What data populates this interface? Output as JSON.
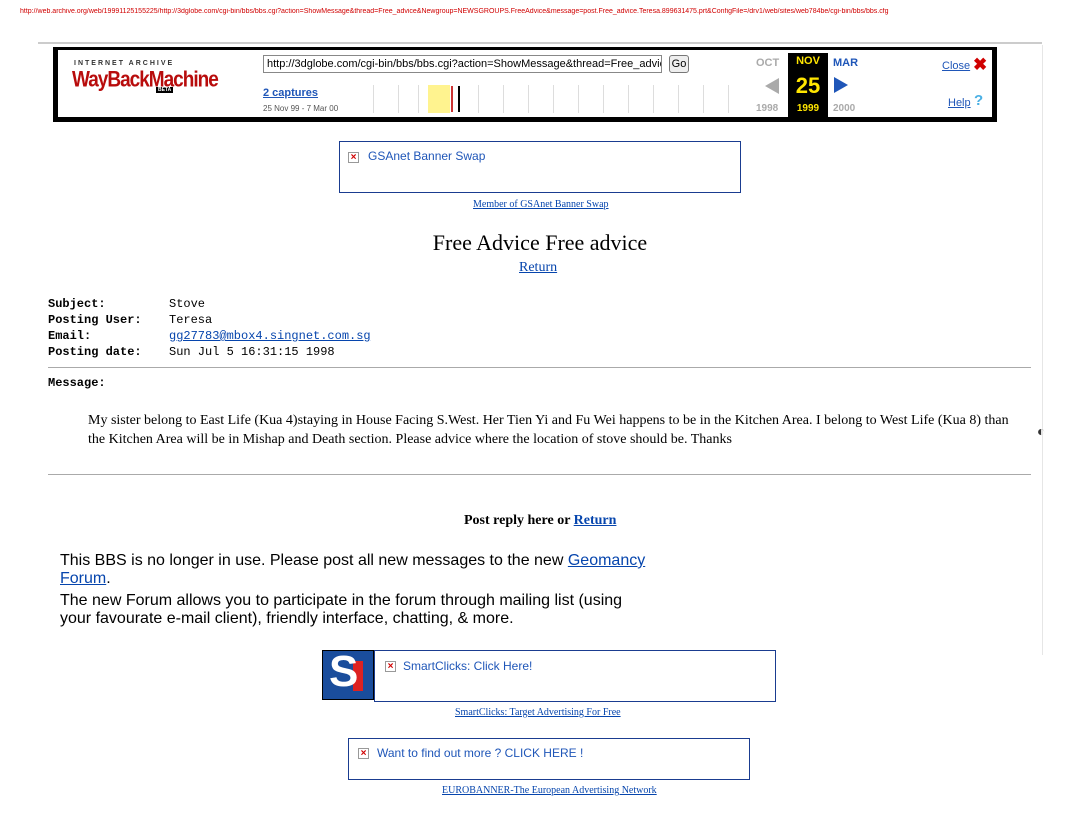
{
  "archive_url": "http://web.archive.org/web/19991125155225/http://3dglobe.com/cgi-bin/bbs/bbs.cgi?action=ShowMessage&thread=Free_advice&Newgroup=NEWSGROUPS.FreeAdvice&message=post.Free_advice.Teresa.899631475.prt&ConfigFile=/drv1/web/sites/web784be/cgi-bin/bbs/bbs.cfg",
  "wayback": {
    "logo_top": "INTERNET ARCHIVE",
    "logo": "WayBackMachine",
    "beta": "BETA",
    "url_value": "http://3dglobe.com/cgi-bin/bbs/bbs.cgi?action=ShowMessage&thread=Free_advice",
    "go_label": "Go",
    "captures_link": "2 captures",
    "capture_range": "25 Nov 99 - 7 Mar 00",
    "prev_month": "OCT",
    "current_month": "NOV",
    "current_day": "25",
    "current_year": "1999",
    "next_month": "MAR",
    "prev_year": "1998",
    "next_year": "2000",
    "close_label": "Close",
    "help_label": "Help"
  },
  "banner_top": {
    "text": "GSAnet Banner Swap",
    "caption": "Member of GSAnet Banner Swap"
  },
  "page": {
    "title": "Free Advice Free advice",
    "return_label": "Return"
  },
  "post": {
    "subject_label": "Subject:",
    "subject": "Stove",
    "user_label": "Posting User:",
    "user": "Teresa",
    "email_label": "Email:",
    "email": "gg27783@mbox4.singnet.com.sg",
    "date_label": "Posting date:",
    "date": "Sun Jul 5 16:31:15 1998",
    "message_label": "Message:",
    "message": "My sister belong to East Life (Kua 4)staying in House Facing S.West. Her Tien Yi and Fu Wei happens to be in the Kitchen Area. I belong to West Life (Kua 8) than the Kitchen Area will be in Mishap and Death section. Please advice where the location of stove should be. Thanks"
  },
  "reply": {
    "text": "Post reply here or",
    "return_label": "Return"
  },
  "notice": {
    "line1_pre": "This BBS is no longer in use. Please post all new messages to the new",
    "forum_link": "Geomancy Forum",
    "line1_post": ".",
    "line2": "The new Forum allows you to participate in the forum through mailing list (using your favourate e-mail client), friendly interface, chatting, & more."
  },
  "banner_smartclicks": {
    "text": "SmartClicks: Click Here!",
    "caption": "SmartClicks: Target Advertising For Free"
  },
  "banner_euro": {
    "text": "Want to find out more ?  CLICK HERE !",
    "caption": "EUROBANNER-The European Advertising Network"
  }
}
